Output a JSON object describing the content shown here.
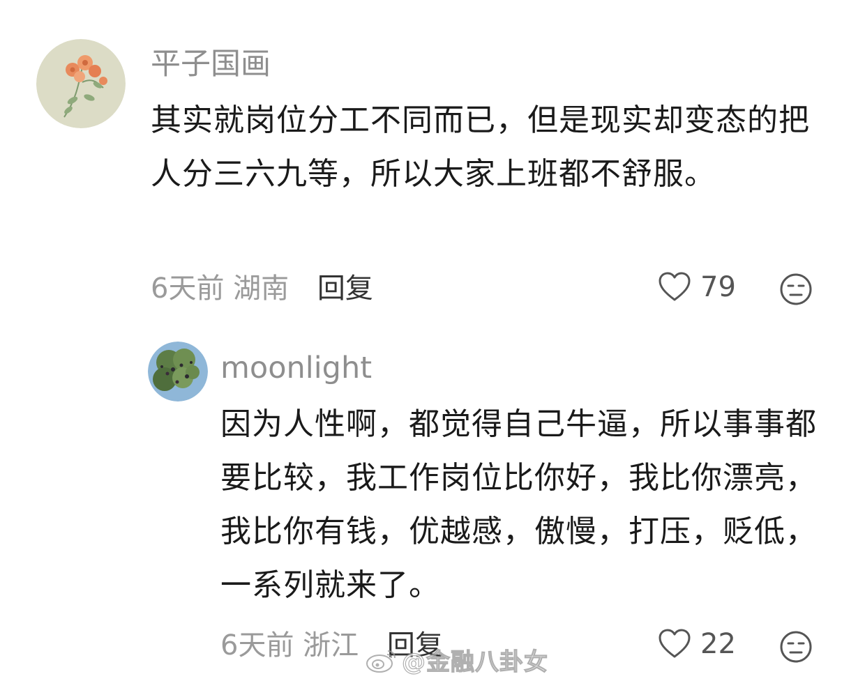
{
  "comments": [
    {
      "username": "平子国画",
      "text": "其实就岗位分工不同而已，但是现实却变态的把人分三六九等，所以大家上班都不舒服。",
      "time": "6天前",
      "region": "湖南",
      "reply_label": "回复",
      "likes": "79"
    },
    {
      "username": "moonlight",
      "text": "因为人性啊，都觉得自己牛逼，所以事事都要比较，我工作岗位比你好，我比你漂亮，我比你有钱，优越感，傲慢，打压，贬低，一系列就来了。",
      "time": "6天前",
      "region": "浙江",
      "reply_label": "回复",
      "likes": "22"
    }
  ],
  "watermark": {
    "text": "@金融八卦女"
  },
  "icons": {
    "like": "heart-outline-icon",
    "dislike": "neutral-face-icon",
    "watermark_logo": "weibo-logo-icon"
  },
  "colors": {
    "username": "#8e8e8e",
    "text": "#1a1a1a",
    "meta": "#9a9a9a",
    "reply_button": "#333333"
  }
}
